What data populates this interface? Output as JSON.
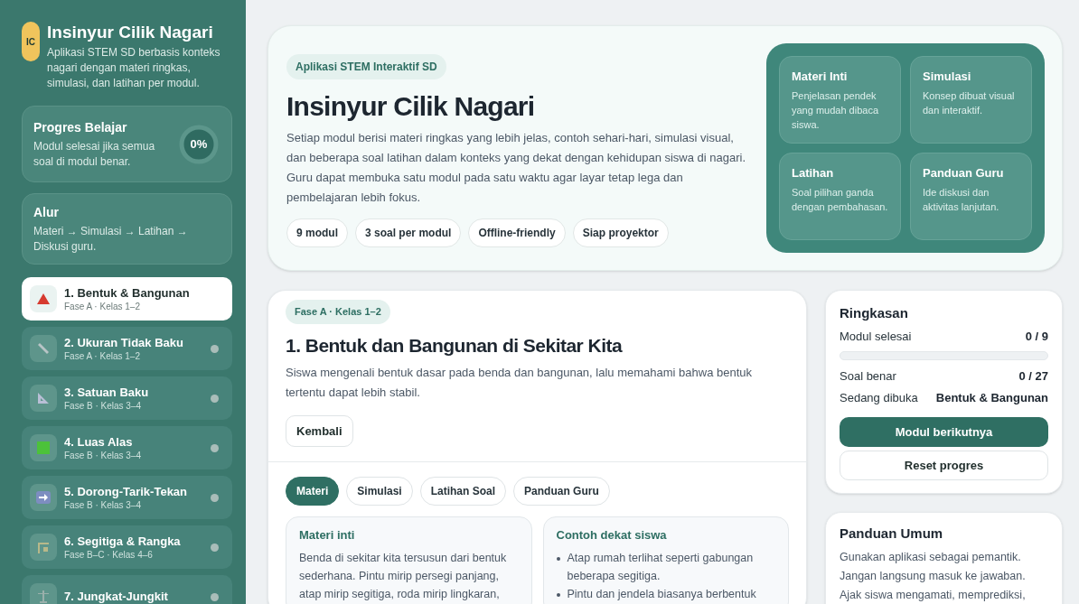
{
  "sidebar": {
    "logo": "IC",
    "title": "Insinyur Cilik Nagari",
    "subtitle": "Aplikasi STEM SD berbasis konteks nagari dengan materi ringkas, simulasi, dan latihan per modul.",
    "progress": {
      "title": "Progres Belajar",
      "text": "Modul selesai jika semua soal di modul benar.",
      "percent": "0%",
      "level": 0
    },
    "flow": {
      "title": "Alur",
      "text": "Materi → Simulasi → Latihan → Diskusi guru."
    },
    "modules": [
      {
        "title": "1. Bentuk & Bangunan",
        "meta": "Fase A · Kelas 1–2",
        "kind": "triangle",
        "selected": true
      },
      {
        "title": "2. Ukuran Tidak Baku",
        "meta": "Fase A · Kelas 1–2",
        "kind": "ruler",
        "selected": false
      },
      {
        "title": "3. Satuan Baku",
        "meta": "Fase B · Kelas 3–4",
        "kind": "set-square",
        "selected": false
      },
      {
        "title": "4. Luas Alas",
        "meta": "Fase B · Kelas 3–4",
        "kind": "square",
        "selected": false
      },
      {
        "title": "5. Dorong-Tarik-Tekan",
        "meta": "Fase B · Kelas 3–4",
        "kind": "arrow",
        "selected": false
      },
      {
        "title": "6. Segitiga & Rangka",
        "meta": "Fase B–C · Kelas 4–6",
        "kind": "frame",
        "selected": false
      },
      {
        "title": "7. Jungkat-Jungkit",
        "kind": "scale",
        "selected": false
      }
    ]
  },
  "hero": {
    "badge": "Aplikasi STEM Interaktif SD",
    "title": "Insinyur Cilik Nagari",
    "text": "Setiap modul berisi materi ringkas yang lebih jelas, contoh sehari-hari, simulasi visual, dan beberapa soal latihan dalam konteks yang dekat dengan kehidupan siswa di nagari. Guru dapat membuka satu modul pada satu waktu agar layar tetap lega dan pembelajaran lebih fokus.",
    "chips": [
      "9 modul",
      "3 soal per modul",
      "Offline-friendly",
      "Siap proyektor"
    ],
    "features": [
      {
        "title": "Materi Inti",
        "text": "Penjelasan pendek yang mudah dibaca siswa."
      },
      {
        "title": "Simulasi",
        "text": "Konsep dibuat visual dan interaktif."
      },
      {
        "title": "Latihan",
        "text": "Soal pilihan ganda dengan pembahasan."
      },
      {
        "title": "Panduan Guru",
        "text": "Ide diskusi dan aktivitas lanjutan."
      }
    ]
  },
  "module": {
    "badge": "Fase A · Kelas 1–2",
    "title": "1. Bentuk dan Bangunan di Sekitar Kita",
    "description": "Siswa mengenali bentuk dasar pada benda dan bangunan, lalu memahami bahwa bentuk tertentu dapat lebih stabil.",
    "back_button": "Kembali",
    "tabs": [
      {
        "label": "Materi",
        "selected": true
      },
      {
        "label": "Simulasi",
        "selected": false
      },
      {
        "label": "Latihan Soal",
        "selected": false
      },
      {
        "label": "Panduan Guru",
        "selected": false
      }
    ],
    "cards": [
      {
        "kind": "text",
        "title": "Materi inti",
        "text": "Benda di sekitar kita tersusun dari bentuk sederhana. Pintu mirip persegi panjang, atap mirip segitiga, roda mirip lingkaran,"
      },
      {
        "kind": "list",
        "title": "Contoh dekat siswa",
        "items": [
          "Atap rumah terlihat seperti gabungan beberapa segitiga.",
          "Pintu dan jendela biasanya berbentuk"
        ]
      }
    ]
  },
  "summary": {
    "title": "Ringkasan",
    "modules_label": "Modul selesai",
    "modules_value": "0 / 9",
    "level": 0,
    "rows": [
      {
        "label": "Soal benar",
        "value": "0 / 27"
      },
      {
        "label": "Sedang dibuka",
        "value": "Bentuk & Bangunan"
      }
    ],
    "primary_button": "Modul berikutnya",
    "secondary_button": "Reset progres"
  },
  "guide": {
    "title": "Panduan Umum",
    "text": "Gunakan aplikasi sebagai pemantik. Jangan langsung masuk ke jawaban. Ajak siswa mengamati, memprediksi,"
  }
}
